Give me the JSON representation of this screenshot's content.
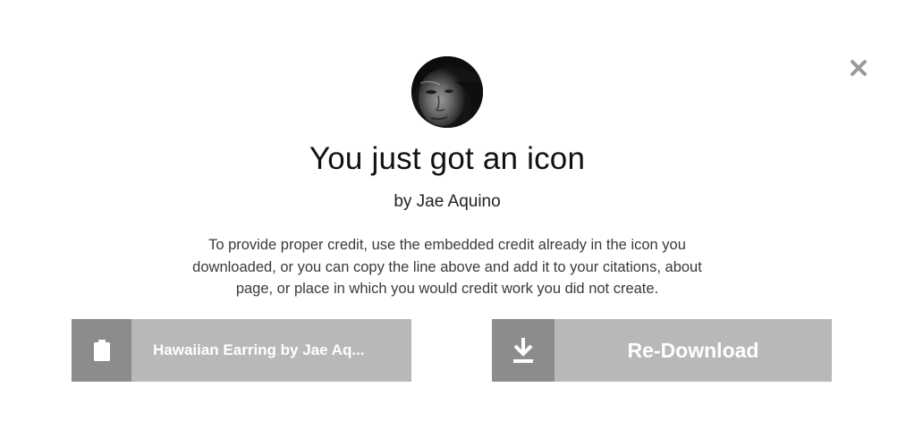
{
  "modal": {
    "close_icon": "close-icon",
    "avatar_icon": "author-avatar",
    "title": "You just got an icon",
    "author": "by Jae Aquino",
    "description": "To provide proper credit, use the embedded credit already in the icon you downloaded, or you can copy the line above and add it to your citations, about page, or place in which you would credit work you did not create.",
    "copy_button": {
      "icon": "clipboard-icon",
      "label": "Hawaiian Earring by Jae Aq..."
    },
    "download_button": {
      "icon": "download-icon",
      "label": "Re-Download"
    },
    "colors": {
      "button_bg": "#b8b8b8",
      "button_icon_bg": "#8c8c8c",
      "close_icon": "#9a9a9a"
    }
  }
}
